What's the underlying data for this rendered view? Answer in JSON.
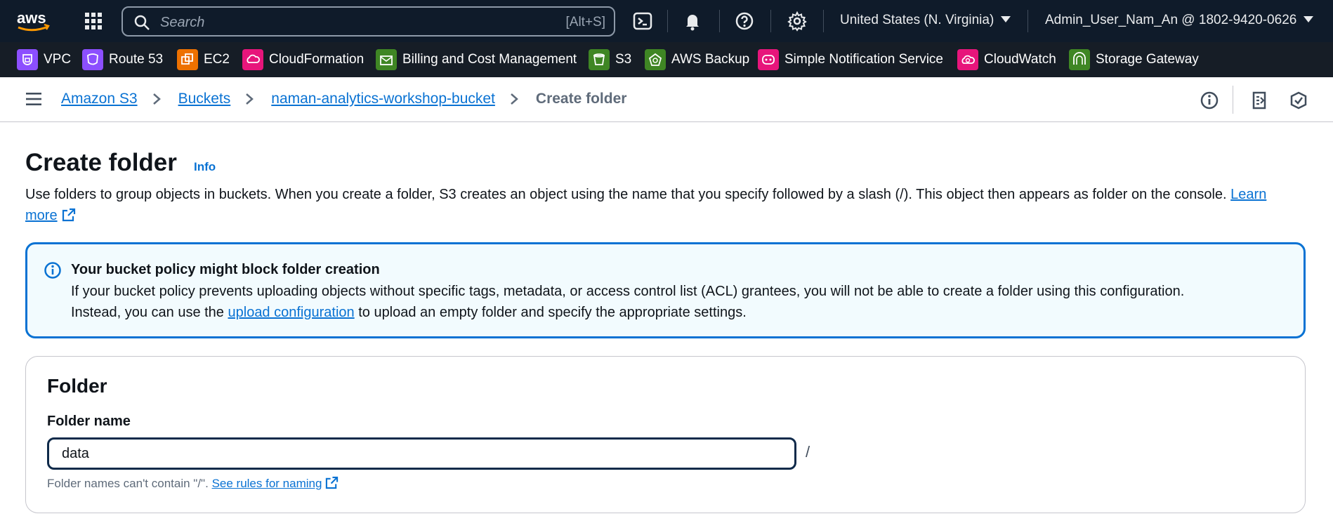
{
  "topnav": {
    "search_placeholder": "Search",
    "search_shortcut": "[Alt+S]",
    "region": "United States (N. Virginia)",
    "account": "Admin_User_Nam_An @ 1802-9420-0626",
    "icons": [
      "aws-logo",
      "services-grid-icon",
      "cloudshell-icon",
      "bell-icon",
      "help-icon",
      "settings-icon"
    ]
  },
  "favorites": [
    {
      "label": "VPC",
      "color": "#8c4fff"
    },
    {
      "label": "Route 53",
      "color": "#8c4fff"
    },
    {
      "label": "EC2",
      "color": "#ed7100"
    },
    {
      "label": "CloudFormation",
      "color": "#e7157b"
    },
    {
      "label": "Billing and Cost Management",
      "color": "#3f8624"
    },
    {
      "label": "S3",
      "color": "#3f8624"
    },
    {
      "label": "AWS Backup",
      "color": "#3f8624"
    },
    {
      "label": "Simple Notification Service",
      "color": "#e7157b"
    },
    {
      "label": "CloudWatch",
      "color": "#e7157b"
    },
    {
      "label": "Storage Gateway",
      "color": "#3f8624"
    }
  ],
  "breadcrumb": {
    "items": [
      "Amazon S3",
      "Buckets",
      "naman-analytics-workshop-bucket"
    ],
    "current": "Create folder"
  },
  "page": {
    "title": "Create folder",
    "info": "Info",
    "description": "Use folders to group objects in buckets. When you create a folder, S3 creates an object using the name that you specify followed by a slash (/). This object then appears as folder on the console.",
    "learn_more": "Learn more"
  },
  "alert": {
    "title": "Your bucket policy might block folder creation",
    "body_before": "If your bucket policy prevents uploading objects without specific tags, metadata, or access control list (ACL) grantees, you will not be able to create a folder using this configuration. Instead, you can use the",
    "link": "upload configuration",
    "body_after": "to upload an empty folder and specify the appropriate settings."
  },
  "folder_panel": {
    "title": "Folder",
    "field_label": "Folder name",
    "field_value": "data",
    "suffix": "/",
    "hint": "Folder names can't contain \"/\".",
    "hint_link": "See rules for naming"
  },
  "colors": {
    "topbar": "#0f1b2a",
    "favbar": "#161d26",
    "link": "#0972d3",
    "alert_border": "#0972d3",
    "alert_bg": "#f2fbfe"
  }
}
